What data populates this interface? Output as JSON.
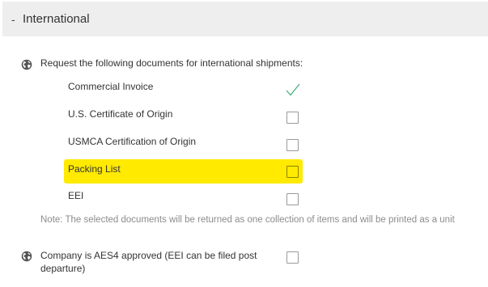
{
  "section": {
    "toggle": "-",
    "title": "International"
  },
  "documents": {
    "prompt": "Request the following documents for international shipments:",
    "items": [
      {
        "label": "Commercial Invoice",
        "checked": true
      },
      {
        "label": "U.S. Certificate of Origin",
        "checked": false
      },
      {
        "label": "USMCA Certification of Origin",
        "checked": false
      },
      {
        "label": "Packing List",
        "checked": false,
        "highlighted": true
      },
      {
        "label": "EEI",
        "checked": false
      }
    ],
    "note": "Note: The selected documents will be returned as one collection of items and will be printed as a unit"
  },
  "aes": {
    "label": "Company is AES4 approved (EEI can be filed post departure)",
    "checked": false
  },
  "colors": {
    "header_bg": "#eeeeee",
    "highlight": "#ffea00",
    "check": "#4caf7d",
    "note_text": "#8c8c8c"
  },
  "icons": {
    "section_icon": "globe-icon",
    "checked_indicator": "checkmark-icon"
  }
}
